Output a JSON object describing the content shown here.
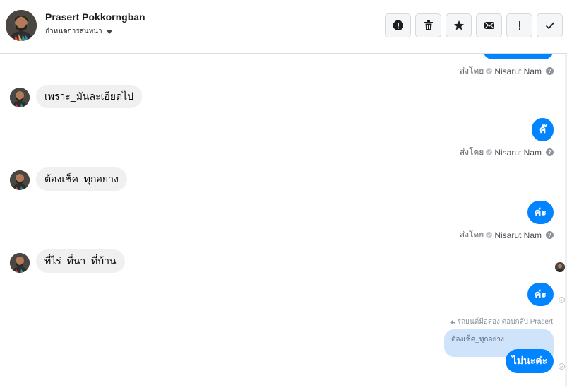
{
  "header": {
    "contact_name": "Prasert Pokkorngban",
    "subtitle": "กำหนดการสนทนา",
    "avatar_icon": "user-avatar",
    "actions": [
      {
        "name": "report-icon",
        "label": "!"
      },
      {
        "name": "trash-icon",
        "label": ""
      },
      {
        "name": "star-icon",
        "label": ""
      },
      {
        "name": "envelope-icon",
        "label": ""
      },
      {
        "name": "exclamation-icon",
        "label": "!"
      },
      {
        "name": "checkmark-icon",
        "label": ""
      }
    ]
  },
  "messages": {
    "sent_by_prefix": "ส่งโดย",
    "sender": "Nisarut Nam",
    "incoming": [
      {
        "text": "เพราะ_มันละเอียดไป"
      },
      {
        "text": "ต้องเช็ค_ทุกอย่าง"
      },
      {
        "text": "ที่ไร่_ที่นา_ที่บ้าน"
      }
    ],
    "outgoing": [
      {
        "text": "ค๊"
      },
      {
        "text": "ค่ะ"
      },
      {
        "text": "ค่ะ"
      },
      {
        "text": "ไม่นะค่ะ"
      }
    ],
    "reply": {
      "header": "รถยนต์มือสอง ตอบกลับ Prasert",
      "quoted_text": "ต้องเช็ค_ทุกอย่าง"
    }
  },
  "colors": {
    "accent": "#0084ff",
    "incoming_bubble": "#f0f0f0",
    "reply_quote": "#cfe3fb"
  }
}
